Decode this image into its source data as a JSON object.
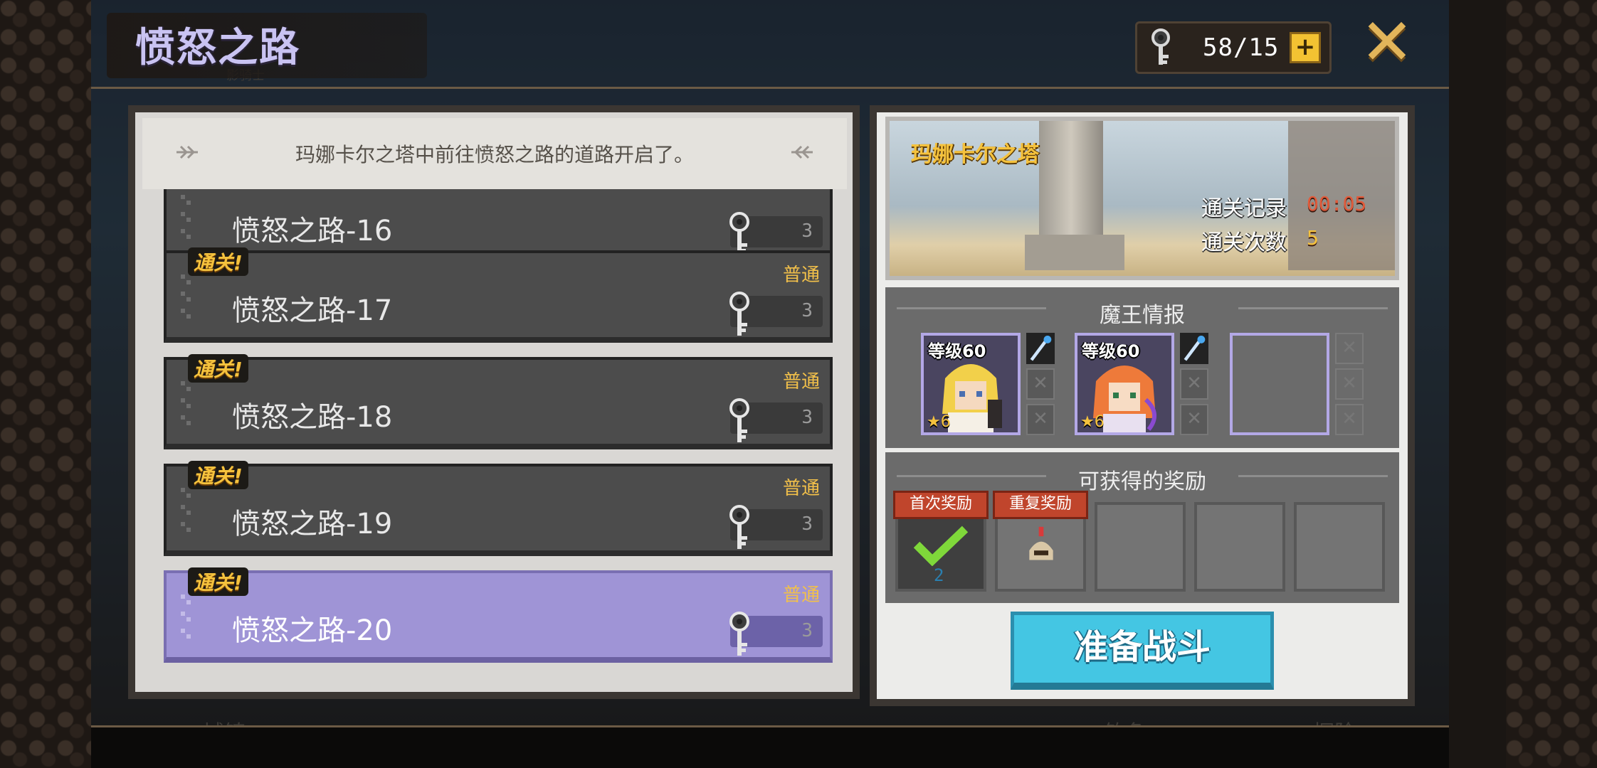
{
  "screen": {
    "title": "愤怒之路",
    "key_counter": "58/15",
    "plus_label": "+",
    "close_label": "✕"
  },
  "background": {
    "ghost_labels": [
      "城镇",
      "钓鱼",
      "探险",
      "影骑士"
    ]
  },
  "stage_list": {
    "header_message": "玛娜卡尔之塔中前往愤怒之路的道路开启了。",
    "items": [
      {
        "name": "愤怒之路-16",
        "cleared": false,
        "difficulty": "",
        "cost": "3",
        "selected": false
      },
      {
        "name": "愤怒之路-17",
        "cleared": true,
        "clear_label": "通关!",
        "difficulty": "普通",
        "cost": "3",
        "selected": false
      },
      {
        "name": "愤怒之路-18",
        "cleared": true,
        "clear_label": "通关!",
        "difficulty": "普通",
        "cost": "3",
        "selected": false
      },
      {
        "name": "愤怒之路-19",
        "cleared": true,
        "clear_label": "通关!",
        "difficulty": "普通",
        "cost": "3",
        "selected": false
      },
      {
        "name": "愤怒之路-20",
        "cleared": true,
        "clear_label": "通关!",
        "difficulty": "普通",
        "cost": "3",
        "selected": true
      }
    ]
  },
  "detail": {
    "tower_name": "玛娜卡尔之塔",
    "record_label": "通关记录",
    "record_value": "00:05",
    "clears_label": "通关次数",
    "clears_value": "5",
    "boss_section_title": "魔王情报",
    "bosses": [
      {
        "level_label": "等级60",
        "stars": "6"
      },
      {
        "level_label": "等级60",
        "stars": "6"
      }
    ],
    "reward_section_title": "可获得的奖励",
    "rewards": [
      {
        "tag": "首次奖励",
        "count": "2",
        "icon": "check-icon"
      },
      {
        "tag": "重复奖励",
        "icon": "helmet-icon"
      }
    ],
    "start_button": "准备战斗"
  },
  "colors": {
    "accent_gold": "#f5c23d",
    "selected_row": "#9f94d6",
    "start_button": "#44c6e3",
    "record_red": "#e25a3a"
  }
}
